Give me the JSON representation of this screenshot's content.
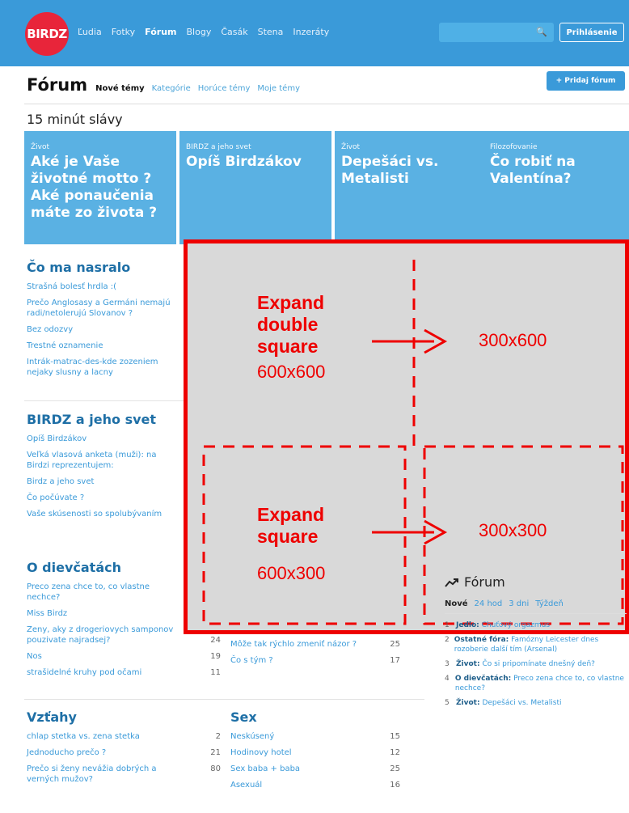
{
  "topbar": {
    "logo": "BIRDZ",
    "nav": [
      "Ľudia",
      "Fotky",
      "Fórum",
      "Blogy",
      "Časák",
      "Stena",
      "Inzeráty"
    ],
    "nav_active": "Fórum",
    "login": "Prihlásenie",
    "colors": {
      "bar": "#3a9ad9",
      "logo": "#e8253a"
    }
  },
  "forum_header": {
    "title": "Fórum",
    "tabs": [
      "Nové témy",
      "Kategórie",
      "Horúce témy",
      "Moje témy"
    ],
    "add_button": "+ Pridaj fórum"
  },
  "fame": {
    "title": "15 minút slávy",
    "tiles": [
      {
        "category": "Život",
        "title": "Aké je Vaše životné motto ? Aké ponaučenia máte zo života ?"
      },
      {
        "category": "BIRDZ a jeho svet",
        "title": "Opíš Birdzákov"
      },
      {
        "category": "Život",
        "title": "Depešáci vs. Metalisti"
      },
      {
        "category": "Filozofovanie",
        "title": "Čo robiť na Valentína?"
      }
    ]
  },
  "sections": {
    "nasralo": {
      "title": "Čo ma nasralo",
      "items": [
        "Strašná bolesť hrdla :(",
        "Prečo Anglosasy a Germáni nemajú radi/netolerujú Slovanov ?",
        "Bez odozvy",
        "Trestné oznamenie",
        "Intrák-matrac-des-kde zozeniem nejaky slusny a lacny"
      ]
    },
    "birdz": {
      "title": "BIRDZ a jeho svet",
      "items": [
        "Opíš Birdzákov",
        "Veľká vlasová anketa (muži): na Birdzi reprezentujem:",
        "Birdz a jeho svet",
        "Čo počúvate ?",
        "Vaše skúsenosti so spolubývaním"
      ]
    },
    "dievcata": {
      "title": "O dievčatách",
      "items": [
        {
          "text": "Preco zena chce to, co vlastne nechce?",
          "n": ""
        },
        {
          "text": "Miss Birdz",
          "n": ""
        },
        {
          "text": "Zeny, aky z drogeriovych samponov pouzivate najradsej?",
          "n": "24"
        },
        {
          "text": "Nos",
          "n": "19"
        },
        {
          "text": "strašidelné kruhy pod očami",
          "n": "11"
        }
      ]
    },
    "middle_fragment": [
      {
        "text": "Môže tak rýchlo zmeniť názor ?",
        "n": "25"
      },
      {
        "text": "Čo s tým ?",
        "n": "17"
      }
    ],
    "vztahy": {
      "title": "Vzťahy",
      "items": [
        {
          "text": "chlap stetka vs. zena stetka",
          "n": "2"
        },
        {
          "text": "Jednoducho prečo ?",
          "n": "21"
        },
        {
          "text": "Prečo si ženy nevážia dobrých a verných mužov?",
          "n": "80"
        }
      ]
    },
    "sex": {
      "title": "Sex",
      "items": [
        {
          "text": "Neskúsený",
          "n": "15"
        },
        {
          "text": "Hodinovy hotel",
          "n": "12"
        },
        {
          "text": "Sex baba + baba",
          "n": "25"
        },
        {
          "text": "Asexuál",
          "n": "16"
        }
      ]
    }
  },
  "overlay": {
    "big_label": [
      "Expand",
      "double",
      "square"
    ],
    "big_size": "600x600",
    "big_target": "300x600",
    "small_label": [
      "Expand",
      "square"
    ],
    "small_size": "600x300",
    "small_target": "300x300",
    "color": "#e00000"
  },
  "right_forum": {
    "title": "Fórum",
    "tabs": [
      "Nové",
      "24 hod",
      "3 dni",
      "Týždeň"
    ],
    "items": [
      {
        "num": "1",
        "cat": "Jedlo:",
        "text": "Chuťový orgazmus"
      },
      {
        "num": "2",
        "cat": "Ostatné fóra:",
        "text": "Famózny Leicester dnes rozoberie další tím (Arsenal)"
      },
      {
        "num": "3",
        "cat": "Život:",
        "text": "Čo si pripomínate dnešný deň?"
      },
      {
        "num": "4",
        "cat": "O dievčatách:",
        "text": "Preco zena chce to, co vlastne nechce?"
      },
      {
        "num": "5",
        "cat": "Život:",
        "text": "Depešáci vs. Metalisti"
      }
    ]
  }
}
